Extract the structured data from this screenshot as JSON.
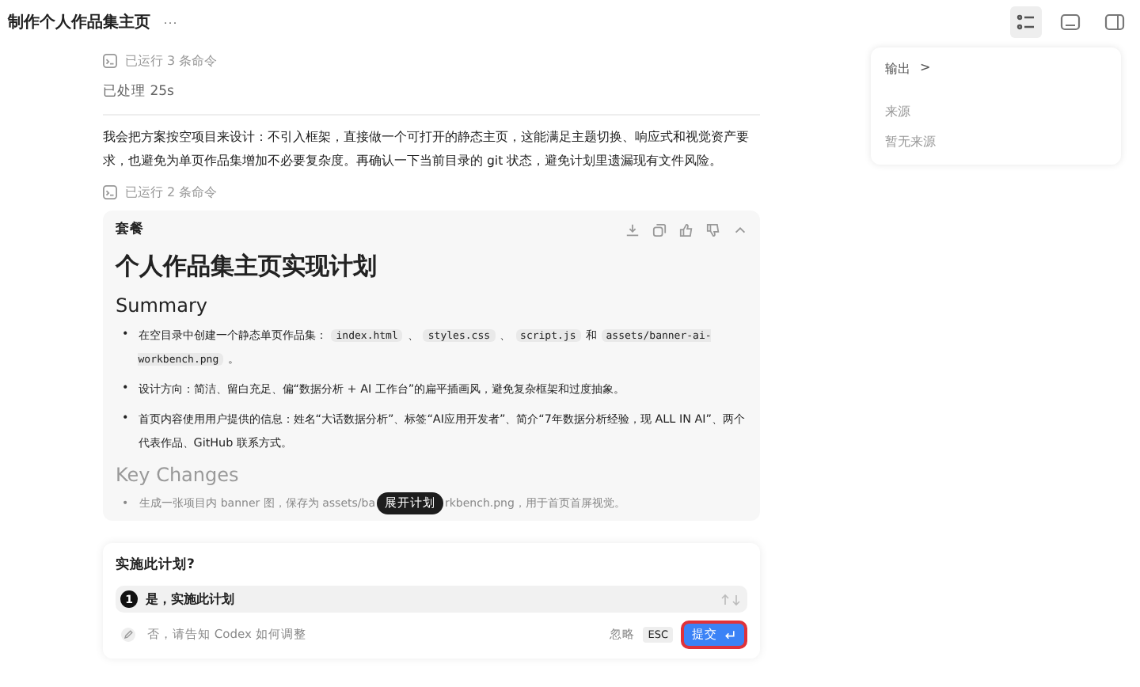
{
  "window": {
    "title": "制作个人作品集主页",
    "more": "···"
  },
  "feed": [
    {
      "kind": "log",
      "text": "已运行 3 条命令"
    },
    {
      "kind": "meta",
      "text": "已处理 25s"
    },
    {
      "kind": "para",
      "text": "我会把方案按空项目来设计：不引入框架，直接做一个可打开的静态主页，这能满足主题切换、响应式和视觉资产要求，也避免为单页作品集增加不必要复杂度。再确认一下当前目录的 git 状态，避免计划里遗漏现有文件风险。"
    },
    {
      "kind": "log",
      "text": "已运行 2 条命令"
    }
  ],
  "side_panel": {
    "output": "输出",
    "output_caret": ">",
    "sources_title": "来源",
    "sources_empty": "暂无来源"
  },
  "plan": {
    "marker": "•",
    "label": "套餐",
    "title": "个人作品集主页实现计划",
    "summary_heading": "Summary",
    "bullets": [
      [
        {
          "kind": "text",
          "text": "在空目录中创建一个静态单页作品集："
        },
        {
          "kind": "code",
          "text": "index.html"
        },
        {
          "kind": "text",
          "text": "、"
        },
        {
          "kind": "code",
          "text": "styles.css"
        },
        {
          "kind": "text",
          "text": "、"
        },
        {
          "kind": "code",
          "text": "script.js"
        },
        {
          "kind": "text",
          "text": "和"
        },
        {
          "kind": "code",
          "text": "assets/banner-ai-workbench.png"
        },
        {
          "kind": "text",
          "text": "。"
        }
      ],
      [
        {
          "kind": "text",
          "text": "设计方向：简洁、留白充足、偏“数据分析 + AI 工作台”的扁平插画风，避免复杂框架和过度抽象。"
        }
      ],
      [
        {
          "kind": "text",
          "text": "首页内容使用用户提供的信息：姓名“大话数据分析”、标签“AI应用开发者”、简介“7年数据分析经验，现 ALL IN AI”、两个代表作品、GitHub 联系方式。"
        }
      ]
    ],
    "key_heading": "Key Changes",
    "faded_before": "生成一张项目内 banner 图，保存为 assets/ba",
    "expand": "展开计划",
    "faded_after": "rkbench.png，用于首页首屏视觉。"
  },
  "question": {
    "title": "实施此计划?",
    "options": [
      {
        "number": "1",
        "text": "是，实施此计划",
        "selected": true
      }
    ],
    "placeholder": "否，请告知 Codex 如何调整",
    "skip": "忽略",
    "esc": "ESC",
    "submit": "提交"
  }
}
